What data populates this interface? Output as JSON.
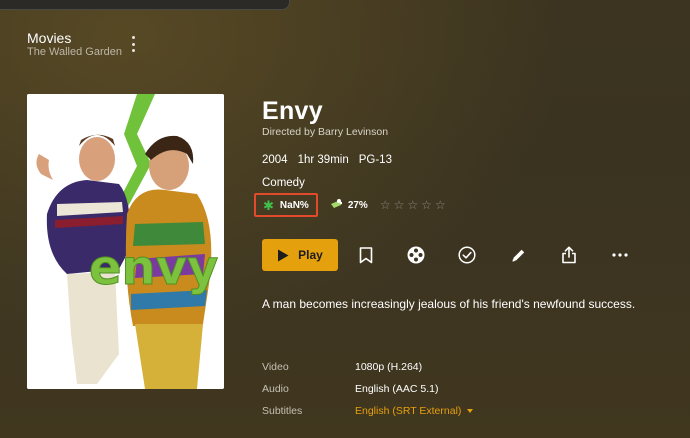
{
  "library": {
    "title": "Movies",
    "subtitle": "The Walled Garden"
  },
  "movie": {
    "title": "Envy",
    "director": "Directed by Barry Levinson",
    "year": "2004",
    "runtime": "1hr 39min",
    "rating": "PG-13",
    "genre": "Comedy",
    "summary": "A man becomes increasingly jealous of his friend's newfound success.",
    "poster_text": "envy"
  },
  "ratings": {
    "critic_label": "NaN%",
    "audience_label": "27%",
    "stars_total": 5,
    "stars_filled": 0
  },
  "actions": {
    "play_label": "Play"
  },
  "tech": {
    "video_label": "Video",
    "video_value": "1080p (H.264)",
    "audio_label": "Audio",
    "audio_value": "English (AAC 5.1)",
    "subtitles_label": "Subtitles",
    "subtitles_value": "English (SRT External)"
  },
  "colors": {
    "accent": "#e5a00d",
    "highlight_box": "#e14a2b",
    "rt_green": "#3fc14c"
  }
}
